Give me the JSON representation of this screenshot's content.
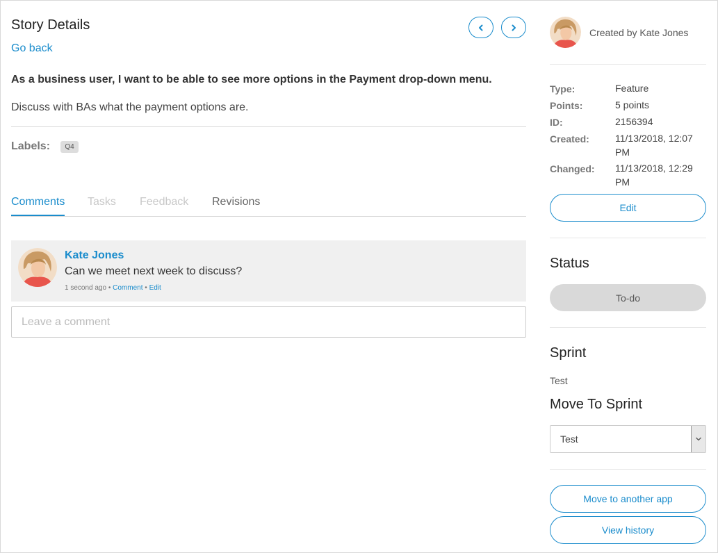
{
  "header": {
    "title": "Story Details",
    "go_back": "Go back"
  },
  "story": {
    "title": "As a business user, I want to be able to see more options in the Payment drop-down menu.",
    "description": "Discuss with BAs what the payment options are.",
    "labels_label": "Labels:",
    "labels": [
      "Q4"
    ]
  },
  "tabs": [
    {
      "label": "Comments",
      "state": "active"
    },
    {
      "label": "Tasks",
      "state": "disabled"
    },
    {
      "label": "Feedback",
      "state": "disabled"
    },
    {
      "label": "Revisions",
      "state": "normal"
    }
  ],
  "comments": [
    {
      "author": "Kate Jones",
      "text": "Can we meet next week to discuss?",
      "time": "1 second ago",
      "separator": "•",
      "comment_link": "Comment",
      "edit_link": "Edit"
    }
  ],
  "comment_input": {
    "placeholder": "Leave a comment"
  },
  "sidebar": {
    "created_by": "Created by Kate Jones",
    "meta": [
      {
        "key": "Type:",
        "value": "Feature"
      },
      {
        "key": "Points:",
        "value": "5 points"
      },
      {
        "key": "ID:",
        "value": "2156394"
      },
      {
        "key": "Created:",
        "value": "11/13/2018, 12:07 PM"
      },
      {
        "key": "Changed:",
        "value": "11/13/2018, 12:29 PM"
      }
    ],
    "edit_button": "Edit",
    "status_heading": "Status",
    "status_value": "To-do",
    "sprint_heading": "Sprint",
    "sprint_value": "Test",
    "move_heading": "Move To Sprint",
    "move_select_value": "Test",
    "move_app_button": "Move to another app",
    "history_button": "View history"
  },
  "colors": {
    "accent": "#1a8ccc",
    "status_bg": "#d9d9d9",
    "comment_bg": "#f0f0f0"
  },
  "icons": [
    "chevron-left-icon",
    "chevron-right-icon",
    "chevron-down-icon",
    "user-avatar"
  ]
}
